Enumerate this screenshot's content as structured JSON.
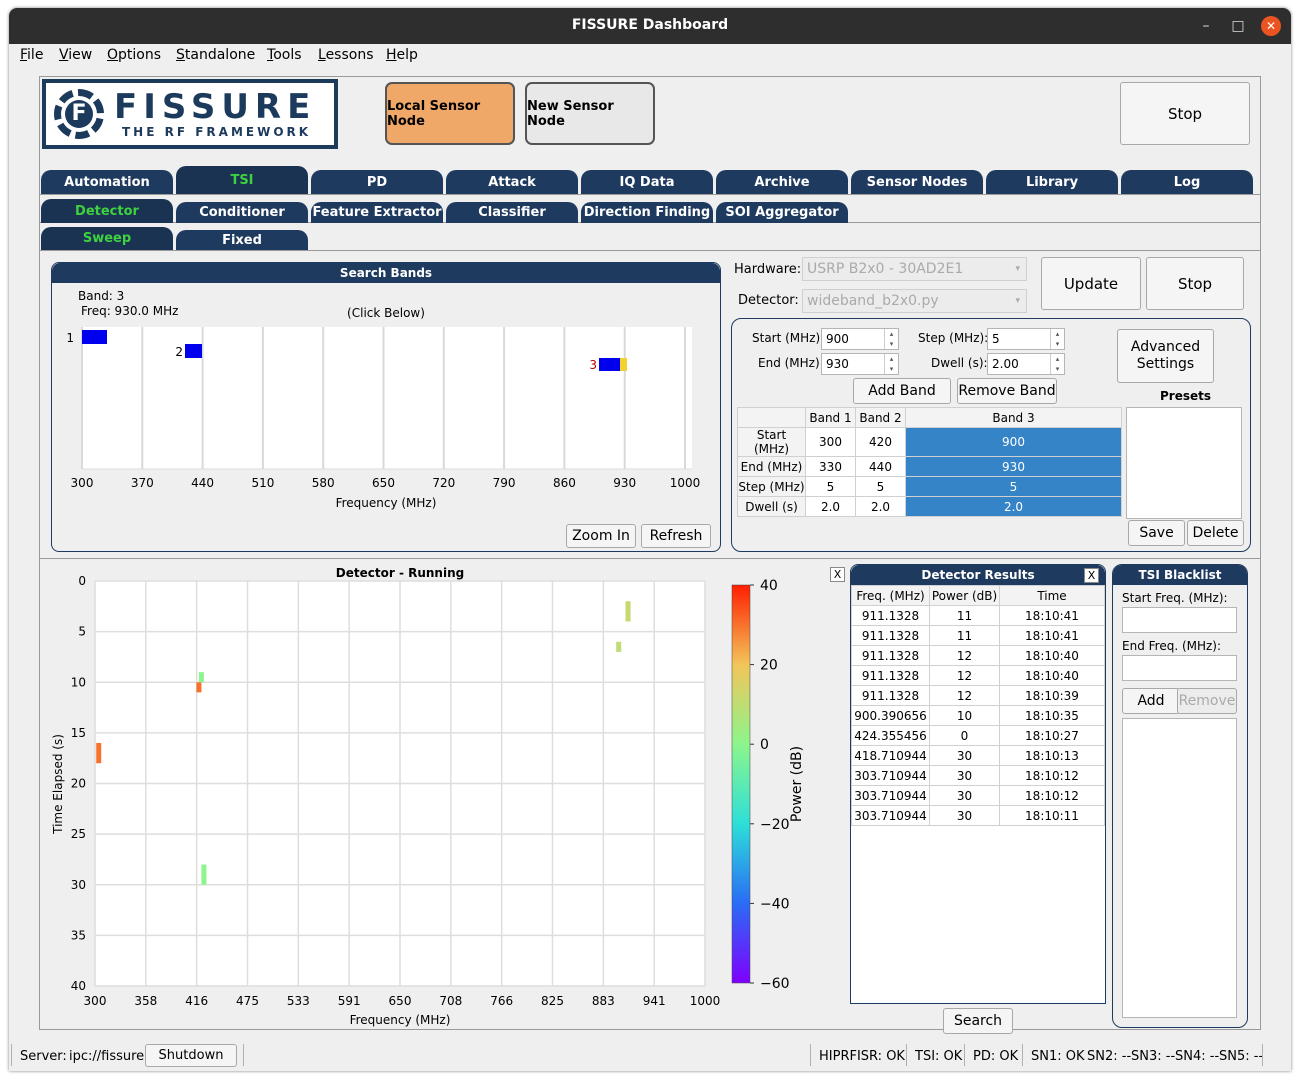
{
  "window": {
    "title": "FISSURE Dashboard",
    "min": "–",
    "max": "□",
    "close": "✕"
  },
  "menu": [
    "File",
    "View",
    "Options",
    "Standalone",
    "Tools",
    "Lessons",
    "Help"
  ],
  "header": {
    "logo_main": "FISSURE",
    "logo_sub": "THE RF FRAMEWORK",
    "local_sensor": "Local Sensor Node",
    "new_sensor": "New Sensor Node",
    "stop": "Stop"
  },
  "tabs_main": [
    "Automation",
    "TSI",
    "PD",
    "Attack",
    "IQ Data",
    "Archive",
    "Sensor Nodes",
    "Library",
    "Log"
  ],
  "tabs_tsi": [
    "Detector",
    "Conditioner",
    "Feature Extractor",
    "Classifier",
    "Direction Finding",
    "SOI Aggregator"
  ],
  "tabs_detector": [
    "Sweep",
    "Fixed"
  ],
  "search_bands": {
    "title": "Search Bands",
    "band_label": "Band:  3",
    "freq_label": "Freq:  930.0 MHz",
    "click_hint": "(Click Below)",
    "xlabel": "Frequency (MHz)",
    "xticks": [
      "300",
      "370",
      "440",
      "510",
      "580",
      "650",
      "720",
      "790",
      "860",
      "930",
      "1000"
    ],
    "band_ids": [
      "1",
      "2",
      "3"
    ],
    "zoom_in": "Zoom In",
    "refresh": "Refresh"
  },
  "config": {
    "hardware_label": "Hardware:",
    "hardware_value": "USRP B2x0 - 30AD2E1",
    "detector_label": "Detector:",
    "detector_value": "wideband_b2x0.py",
    "update": "Update",
    "stop": "Stop",
    "start_label": "Start (MHz):",
    "start_value": "900",
    "end_label": "End (MHz):",
    "end_value": "930",
    "step_label": "Step (MHz):",
    "step_value": "5",
    "dwell_label": "Dwell (s):",
    "dwell_value": "2.00",
    "advanced": "Advanced Settings",
    "add_band": "Add Band",
    "remove_band": "Remove Band",
    "presets": "Presets",
    "save": "Save",
    "delete": "Delete"
  },
  "band_table": {
    "headers": [
      "",
      "Band 1",
      "Band 2",
      "Band 3"
    ],
    "rows": [
      [
        "Start (MHz)",
        "300",
        "420",
        "900"
      ],
      [
        "End (MHz)",
        "330",
        "440",
        "930"
      ],
      [
        "Step (MHz)",
        "5",
        "5",
        "5"
      ],
      [
        "Dwell (s)",
        "2.0",
        "2.0",
        "2.0"
      ]
    ]
  },
  "waterfall": {
    "title": "Detector - Running",
    "xlabel": "Frequency (MHz)",
    "ylabel": "Time Elapsed (s)",
    "xticks": [
      "300",
      "358",
      "416",
      "475",
      "533",
      "591",
      "650",
      "708",
      "766",
      "825",
      "883",
      "941",
      "1000"
    ],
    "yticks": [
      "0",
      "5",
      "10",
      "15",
      "20",
      "25",
      "30",
      "35",
      "40"
    ],
    "cbar_label": "Power (dB)",
    "cbar_ticks": [
      "40",
      "20",
      "0",
      "−20",
      "−40",
      "−60"
    ],
    "close_x": "X"
  },
  "chart_data": {
    "type": "heatmap",
    "title": "Detector - Running",
    "xlabel": "Frequency (MHz)",
    "ylabel": "Time Elapsed (s)",
    "xlim": [
      300,
      1000
    ],
    "ylim": [
      40,
      0
    ],
    "colorbar": {
      "label": "Power (dB)",
      "range": [
        -60,
        40
      ]
    },
    "points": [
      {
        "freq": 303.7,
        "t0": 16,
        "t1": 18,
        "power": 30
      },
      {
        "freq": 418.7,
        "t0": 10,
        "t1": 11,
        "power": 30
      },
      {
        "freq": 421.5,
        "t0": 9,
        "t1": 10,
        "power": 0
      },
      {
        "freq": 424.4,
        "t0": 28,
        "t1": 30,
        "power": 0
      },
      {
        "freq": 900.4,
        "t0": 6,
        "t1": 7,
        "power": 10
      },
      {
        "freq": 911.1,
        "t0": 2,
        "t1": 4,
        "power": 12
      }
    ]
  },
  "results": {
    "title": "Detector Results",
    "close_x": "X",
    "headers": [
      "Freq. (MHz)",
      "Power (dB)",
      "Time"
    ],
    "rows": [
      [
        "911.1328",
        "11",
        "18:10:41"
      ],
      [
        "911.1328",
        "11",
        "18:10:41"
      ],
      [
        "911.1328",
        "12",
        "18:10:40"
      ],
      [
        "911.1328",
        "12",
        "18:10:40"
      ],
      [
        "911.1328",
        "12",
        "18:10:39"
      ],
      [
        "900.390656",
        "10",
        "18:10:35"
      ],
      [
        "424.355456",
        "0",
        "18:10:27"
      ],
      [
        "418.710944",
        "30",
        "18:10:13"
      ],
      [
        "303.710944",
        "30",
        "18:10:12"
      ],
      [
        "303.710944",
        "30",
        "18:10:12"
      ],
      [
        "303.710944",
        "30",
        "18:10:11"
      ]
    ],
    "search": "Search"
  },
  "blacklist": {
    "title": "TSI Blacklist",
    "start_label": "Start Freq. (MHz):",
    "end_label": "End Freq. (MHz):",
    "add": "Add",
    "remove": "Remove"
  },
  "status": {
    "server_label": "Server:",
    "server_value": "ipc://fissure",
    "shutdown": "Shutdown",
    "hiprfisr": "HIPRFISR: OK",
    "tsi": "TSI: OK",
    "pd": "PD: OK",
    "sn1": "SN1: OK",
    "sn2": "SN2: --",
    "sn3": "SN3: --",
    "sn4": "SN4: --",
    "sn5": "SN5: --"
  },
  "colors": {
    "navy": "#1f3a5f",
    "orange": "#f0a868",
    "selected": "#3584c7",
    "active_tab_text": "#3fd13f"
  }
}
